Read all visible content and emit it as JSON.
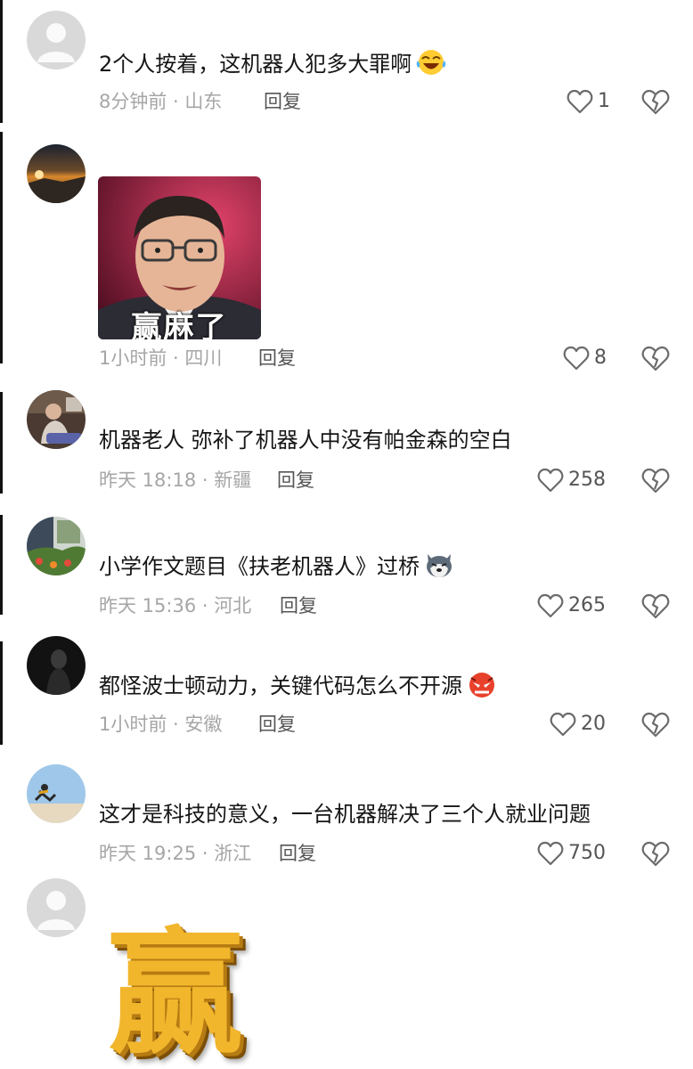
{
  "comments": [
    {
      "text": "2个人按着，这机器人犯多大罪啊",
      "emoji": "laughing-tears-emoji",
      "time": "8分钟前",
      "region": "山东",
      "reply_label": "回复",
      "likes": "1"
    },
    {
      "sticker_caption": "赢麻了",
      "time": "1小时前",
      "region": "四川",
      "reply_label": "回复",
      "likes": "8"
    },
    {
      "text": "机器老人 弥补了机器人中没有帕金森的空白",
      "time": "昨天 18:18",
      "region": "新疆",
      "reply_label": "回复",
      "likes": "258"
    },
    {
      "text": "小学作文题目《扶老机器人》过桥",
      "emoji": "husky-dog-emoji",
      "time": "昨天 15:36",
      "region": "河北",
      "reply_label": "回复",
      "likes": "265"
    },
    {
      "text": "都怪波士顿动力，关键代码怎么不开源",
      "emoji": "angry-face-emoji",
      "time": "1小时前",
      "region": "安徽",
      "reply_label": "回复",
      "likes": "20"
    },
    {
      "text": "这才是科技的意义，一台机器解决了三个人就业问题",
      "time": "昨天 19:25",
      "region": "浙江",
      "reply_label": "回复",
      "likes": "750"
    },
    {
      "sticker_caption": "赢"
    }
  ],
  "icons": {
    "like": "heart-outline-icon",
    "dislike": "broken-heart-icon",
    "default_avatar": "default-avatar-icon"
  },
  "colors": {
    "meta_gray": "#a6a6a6",
    "sticker_gold": "#f1b62c"
  }
}
